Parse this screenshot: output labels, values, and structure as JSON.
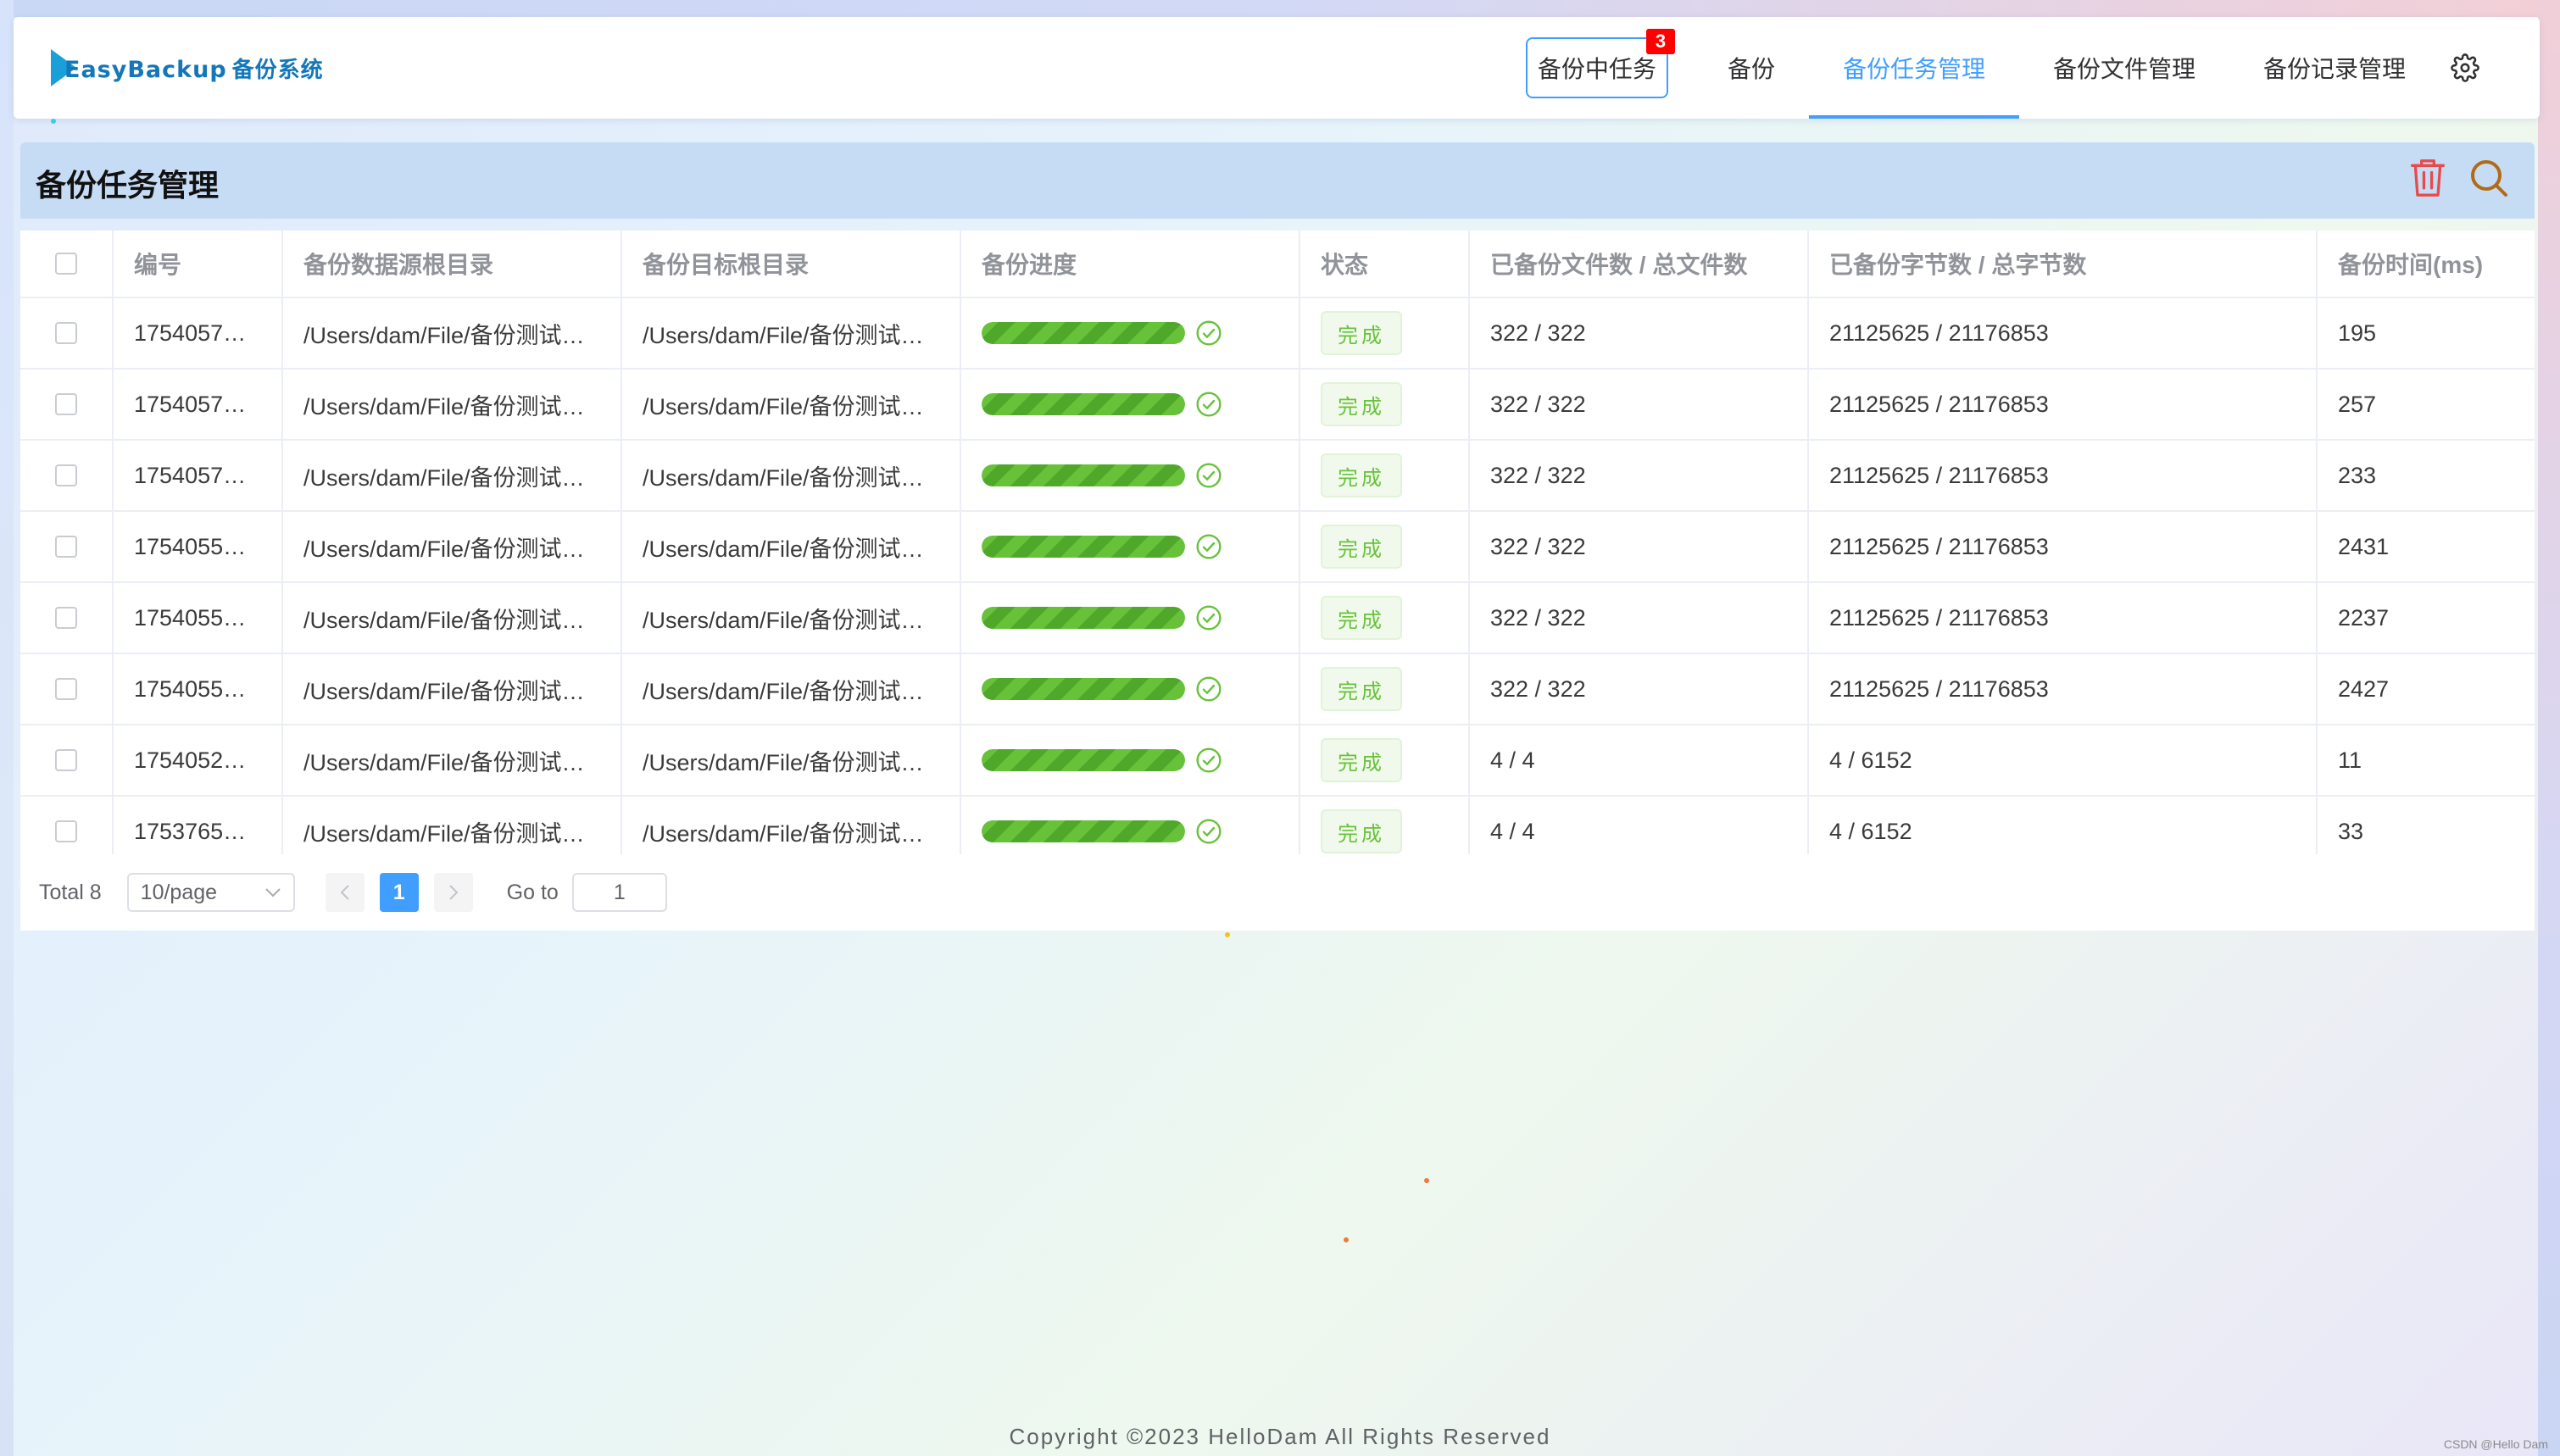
{
  "header": {
    "logo_text": "EasyBackup",
    "logo_sub": "备份系统",
    "running_tasks_label": "备份中任务",
    "running_tasks_badge": "3",
    "nav": [
      {
        "label": "备份"
      },
      {
        "label": "备份任务管理",
        "active": true
      },
      {
        "label": "备份文件管理"
      },
      {
        "label": "备份记录管理"
      }
    ],
    "settings_icon": "gear-icon"
  },
  "panel": {
    "title": "备份任务管理",
    "icons": [
      "trash-icon",
      "search-icon"
    ],
    "delete_color": "#e84b4b",
    "search_color": "#b06b14"
  },
  "table": {
    "columns": [
      "编号",
      "备份数据源根目录",
      "备份目标根目录",
      "备份进度",
      "状态",
      "已备份文件数 / 总文件数",
      "已备份字节数 / 总字节数",
      "备份时间(ms)"
    ],
    "rows": [
      {
        "id": "1754057…",
        "source": "/Users/dam/File/备份测试…",
        "target": "/Users/dam/File/备份测试…",
        "progress": 100,
        "status": "完成",
        "files": "322 / 322",
        "bytes": "21125625 / 21176853",
        "time": "195"
      },
      {
        "id": "1754057…",
        "source": "/Users/dam/File/备份测试…",
        "target": "/Users/dam/File/备份测试…",
        "progress": 100,
        "status": "完成",
        "files": "322 / 322",
        "bytes": "21125625 / 21176853",
        "time": "257"
      },
      {
        "id": "1754057…",
        "source": "/Users/dam/File/备份测试…",
        "target": "/Users/dam/File/备份测试…",
        "progress": 100,
        "status": "完成",
        "files": "322 / 322",
        "bytes": "21125625 / 21176853",
        "time": "233"
      },
      {
        "id": "1754055…",
        "source": "/Users/dam/File/备份测试…",
        "target": "/Users/dam/File/备份测试…",
        "progress": 100,
        "status": "完成",
        "files": "322 / 322",
        "bytes": "21125625 / 21176853",
        "time": "2431"
      },
      {
        "id": "1754055…",
        "source": "/Users/dam/File/备份测试…",
        "target": "/Users/dam/File/备份测试…",
        "progress": 100,
        "status": "完成",
        "files": "322 / 322",
        "bytes": "21125625 / 21176853",
        "time": "2237"
      },
      {
        "id": "1754055…",
        "source": "/Users/dam/File/备份测试…",
        "target": "/Users/dam/File/备份测试…",
        "progress": 100,
        "status": "完成",
        "files": "322 / 322",
        "bytes": "21125625 / 21176853",
        "time": "2427"
      },
      {
        "id": "1754052…",
        "source": "/Users/dam/File/备份测试…",
        "target": "/Users/dam/File/备份测试…",
        "progress": 100,
        "status": "完成",
        "files": "4 / 4",
        "bytes": "4 / 6152",
        "time": "11"
      },
      {
        "id": "1753765…",
        "source": "/Users/dam/File/备份测试…",
        "target": "/Users/dam/File/备份测试…",
        "progress": 100,
        "status": "完成",
        "files": "4 / 4",
        "bytes": "4 / 6152",
        "time": "33"
      }
    ]
  },
  "pagination": {
    "total": "Total 8",
    "page_size": "10/page",
    "current_page": "1",
    "goto_label": "Go to",
    "goto_value": "1"
  },
  "footer": {
    "text": "Copyright  ©2023  HelloDam  All Rights Reserved",
    "watermark": "CSDN @Hello Dam"
  },
  "colors": {
    "accent": "#409eff",
    "success": "#67c23a",
    "badge": "#ff0000",
    "panel_header": "#c6dcf5"
  }
}
